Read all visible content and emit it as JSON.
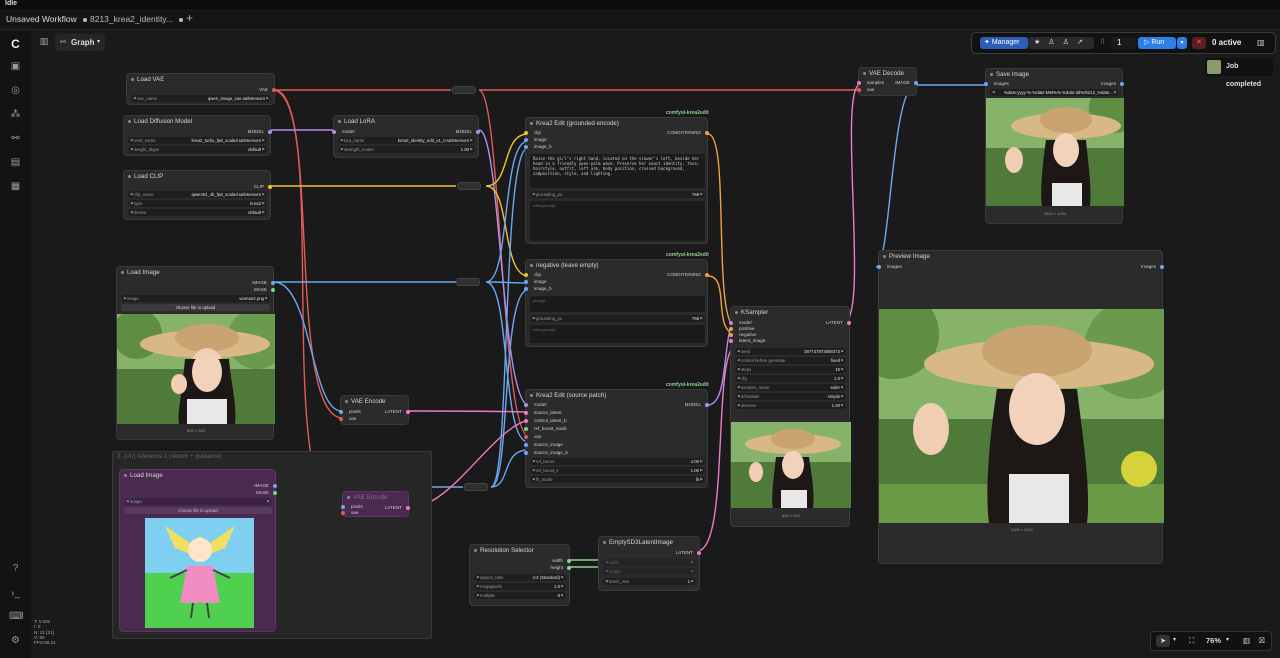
{
  "window": {
    "title": "Idle"
  },
  "tabs": [
    {
      "label": "Unsaved Workflow"
    },
    {
      "label": "8213_krea2_identity..."
    }
  ],
  "toolbar": {
    "graph_label": "Graph",
    "manager_label": "Manager",
    "queue_count": "1",
    "run_label": "Run",
    "active_label": "0 active"
  },
  "toast": {
    "label": "Job completed"
  },
  "zoom": {
    "label": "76%"
  },
  "stats": {
    "lines": [
      "T: 0.00s",
      "I: 0",
      "N: 21 [21]",
      "V: 60",
      "FPS:59.21"
    ]
  },
  "nodes": {
    "load_vae": {
      "title": "Load VAE",
      "out": "VAE",
      "widgets": [
        {
          "name": "vae_name",
          "value": "qwen_image_vae.safetensors"
        }
      ]
    },
    "load_diffusion": {
      "title": "Load Diffusion Model",
      "out": "MODEL",
      "widgets": [
        {
          "name": "unet_name",
          "value": "krea2_turbo_fp8_scaled.safetensors"
        },
        {
          "name": "weight_dtype",
          "value": "default"
        }
      ]
    },
    "load_lora": {
      "title": "Load LoRA",
      "in": "model",
      "out": "MODEL",
      "widgets": [
        {
          "name": "lora_name",
          "value": "krea2_identity_edit_v1_0.safetensors"
        },
        {
          "name": "strength_model",
          "value": "1.00"
        }
      ]
    },
    "load_clip": {
      "title": "Load CLIP",
      "out": "CLIP",
      "widgets": [
        {
          "name": "clip_name",
          "value": "qwen3vl_4b_fp8_scaled.safetensors"
        },
        {
          "name": "type",
          "value": "krea2"
        },
        {
          "name": "device",
          "value": "default"
        }
      ]
    },
    "load_image": {
      "title": "Load Image",
      "outs": [
        "IMAGE",
        "MASK"
      ],
      "widgets": [
        {
          "name": "image",
          "value": "woman2.png"
        }
      ],
      "upload": "choose file to upload",
      "caption": "800 × 942"
    },
    "krea_grounded": {
      "badge": "comfyui-krea2edit",
      "title": "Krea2 Edit (grounded encode)",
      "ins": [
        "clip",
        "image",
        "image_b"
      ],
      "out": "CONDITIONING",
      "prompt": "Raise the girl's right hand, located on the viewer's left, beside her head in a friendly open-palm wave. Preserve her exact identity, face, hairstyle, outfit, left arm, body position, crossed background, composition, style, and lighting.",
      "widgets": [
        {
          "name": "grounding_px",
          "value": "768"
        }
      ],
      "placeholder": "extra prompt"
    },
    "negative": {
      "badge": "comfyui-krea2edit",
      "title": "negative (leave empty)",
      "ins": [
        "clip",
        "image",
        "image_b"
      ],
      "out": "CONDITIONING",
      "placeholder": "prompt",
      "widgets": [
        {
          "name": "grounding_px",
          "value": "768"
        }
      ],
      "placeholder2": "extra prompt"
    },
    "krea_source": {
      "badge": "comfyui-krea2edit",
      "title": "Krea2 Edit (source patch)",
      "ins": [
        "model",
        "source_latent",
        "control_latent_b",
        "ref_boost_mask",
        "vae",
        "source_image",
        "source_image_b"
      ],
      "out": "MODEL",
      "widgets": [
        {
          "name": "ref_boost",
          "value": "4.00"
        },
        {
          "name": "ref_boost_e",
          "value": "1.00"
        },
        {
          "name": "fit_mode",
          "value": "fit"
        }
      ]
    },
    "ksampler": {
      "title": "KSampler",
      "ins": [
        "model",
        "positive",
        "negative",
        "latent_image"
      ],
      "out": "LATENT",
      "widgets": [
        {
          "name": "seed",
          "value": "397747873069373"
        },
        {
          "name": "control before generate",
          "value": "fixed"
        },
        {
          "name": "steps",
          "value": "10"
        },
        {
          "name": "cfg",
          "value": "1.0"
        },
        {
          "name": "sampler_name",
          "value": "euler"
        },
        {
          "name": "scheduler",
          "value": "simple"
        },
        {
          "name": "denoise",
          "value": "1.00"
        }
      ],
      "caption": "800 × 942"
    },
    "vae_decode": {
      "title": "VAE Decode",
      "ins": [
        "samples",
        "vae"
      ],
      "out": "IMAGE"
    },
    "save_image": {
      "title": "Save Image",
      "in": "images",
      "out": "images",
      "widgets": [
        {
          "name": "",
          "value": "%date:yyyy-%-%date:MM%%-%date:dd%/8213_%date..."
        }
      ],
      "caption": "1024 × 1024"
    },
    "preview_image": {
      "title": "Preview Image",
      "in": "images",
      "out": "images",
      "caption": "1024 × 1024"
    },
    "vae_encode": {
      "title": "VAE Encode",
      "ins": [
        "pixels",
        "vae"
      ],
      "out": "LATENT"
    },
    "vae_encode2": {
      "title": "VAE Encode",
      "ins": [
        "pixels",
        "vae"
      ],
      "out": "LATENT"
    },
    "group": {
      "title": "2. (Un) reference 1 (sketch + guidance)"
    },
    "load_image2": {
      "title": "Load Image",
      "outs": [
        "IMAGE",
        "MASK"
      ],
      "widgets": [
        {
          "name": "image",
          "value": ""
        }
      ],
      "upload": "choose file to upload"
    },
    "resolution": {
      "title": "Resolution Selector",
      "outs": [
        "width",
        "height"
      ],
      "widgets": [
        {
          "name": "aspect_ratio",
          "value": "4:3 (Standard)"
        },
        {
          "name": "megapixels",
          "value": "1.0"
        },
        {
          "name": "multiple",
          "value": "8"
        }
      ]
    },
    "empty_latent": {
      "title": "EmptySD3LatentImage",
      "out": "LATENT",
      "widgets": [
        {
          "name": "width",
          "value": ""
        },
        {
          "name": "height",
          "value": ""
        },
        {
          "name": "batch_size",
          "value": "1"
        }
      ]
    }
  }
}
